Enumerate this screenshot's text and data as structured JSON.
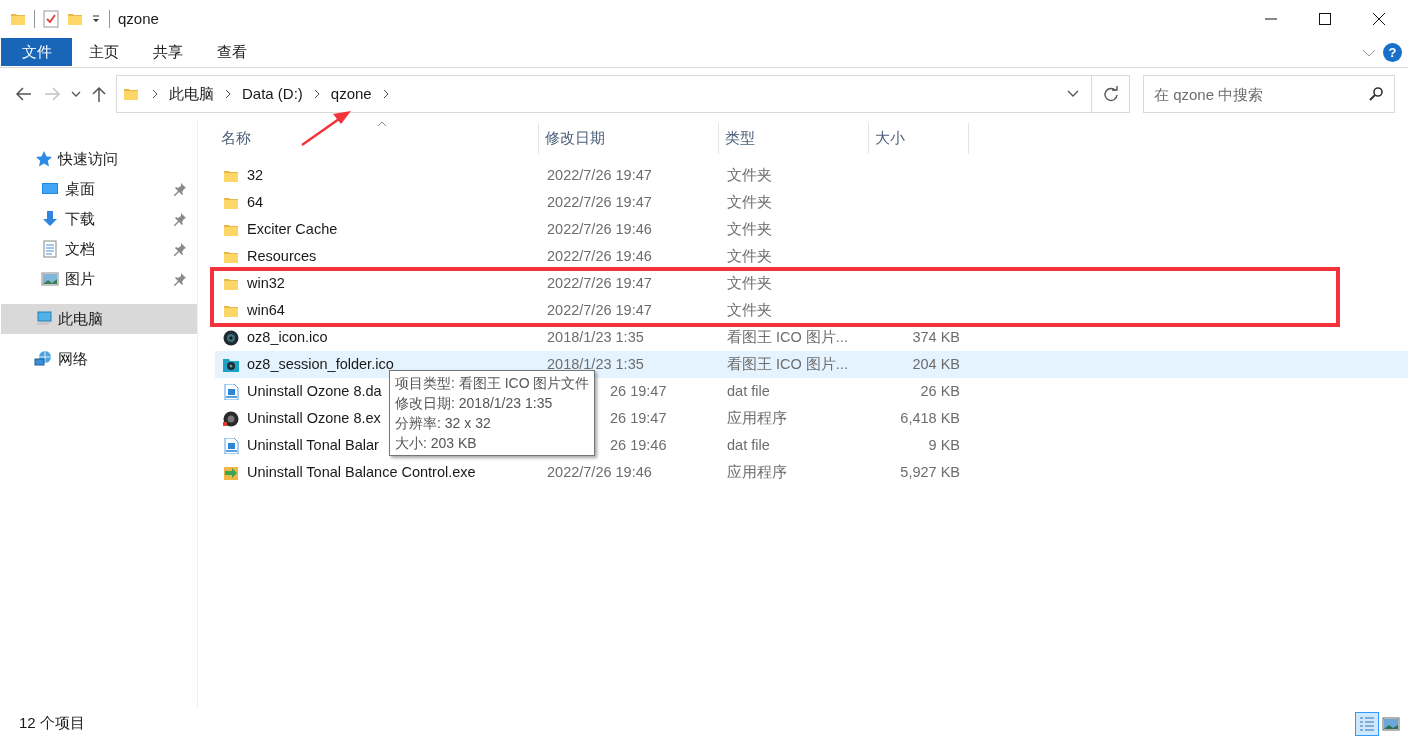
{
  "window": {
    "title": "qzone"
  },
  "ribbon": {
    "tabs": [
      {
        "label": "文件",
        "selected": true
      },
      {
        "label": "主页",
        "selected": false
      },
      {
        "label": "共享",
        "selected": false
      },
      {
        "label": "查看",
        "selected": false
      }
    ],
    "help": "?"
  },
  "address": {
    "back_disabled": false,
    "forward_disabled": true,
    "crumbs": [
      "此电脑",
      "Data (D:)",
      "qzone"
    ],
    "search": {
      "placeholder": "在 qzone 中搜索"
    }
  },
  "sidebar": {
    "items": [
      {
        "label": "快速访问",
        "kind": "star",
        "selected": false,
        "children": [
          {
            "label": "桌面",
            "kind": "desktop",
            "pinned": true,
            "selected": false
          },
          {
            "label": "下载",
            "kind": "download",
            "pinned": true,
            "selected": false
          },
          {
            "label": "文档",
            "kind": "document",
            "pinned": true,
            "selected": false
          },
          {
            "label": "图片",
            "kind": "picture",
            "pinned": true,
            "selected": false
          }
        ]
      },
      {
        "label": "此电脑",
        "kind": "computer",
        "selected": true
      },
      {
        "label": "网络",
        "kind": "network",
        "selected": false
      }
    ]
  },
  "table": {
    "columns": [
      {
        "label": "名称",
        "sorted": true
      },
      {
        "label": "修改日期",
        "sorted": false
      },
      {
        "label": "类型",
        "sorted": false
      },
      {
        "label": "大小",
        "sorted": false
      }
    ],
    "rows": [
      {
        "kind": "folder",
        "name": "32",
        "date": "2022/7/26 19:47",
        "type": "文件夹",
        "hovered": false,
        "highlighted": false
      },
      {
        "kind": "folder",
        "name": "64",
        "date": "2022/7/26 19:47",
        "type": "文件夹",
        "hovered": false,
        "highlighted": false
      },
      {
        "kind": "folder",
        "name": "Exciter Cache",
        "date": "2022/7/26 19:46",
        "type": "文件夹",
        "hovered": false,
        "highlighted": false
      },
      {
        "kind": "folder",
        "name": "Resources",
        "date": "2022/7/26 19:46",
        "type": "文件夹",
        "hovered": false,
        "highlighted": false
      },
      {
        "kind": "folder",
        "name": "win32",
        "date": "2022/7/26 19:47",
        "type": "文件夹",
        "hovered": false,
        "highlighted": true
      },
      {
        "kind": "folder",
        "name": "win64",
        "date": "2022/7/26 19:47",
        "type": "文件夹",
        "hovered": false,
        "highlighted": true
      },
      {
        "kind": "ico",
        "name": "oz8_icon.ico",
        "date": "2018/1/23 1:35",
        "type": "看图王 ICO 图片...",
        "size": "374 KB",
        "hovered": false,
        "highlighted": false
      },
      {
        "kind": "ico-folder",
        "name": "oz8_session_folder.ico",
        "date": "2018/1/23 1:35",
        "type": "看图王 ICO 图片...",
        "size": "204 KB",
        "hovered": true,
        "highlighted": false
      },
      {
        "kind": "dat",
        "name": "Uninstall Ozone 8.da",
        "date": "26 19:47",
        "type": "dat file",
        "size": "26 KB",
        "hovered": false,
        "highlighted": false
      },
      {
        "kind": "exe-dark",
        "name": "Uninstall Ozone 8.ex",
        "date": "26 19:47",
        "type": "应用程序",
        "size": "6,418 KB",
        "hovered": false,
        "highlighted": false
      },
      {
        "kind": "dat",
        "name": "Uninstall Tonal Balar",
        "date": "26 19:46",
        "type": "dat file",
        "size": "9 KB",
        "hovered": false,
        "highlighted": false
      },
      {
        "kind": "exe-arrow",
        "name": "Uninstall Tonal Balance Control.exe",
        "date": "2022/7/26 19:46",
        "type": "应用程序",
        "size": "5,927 KB",
        "hovered": false,
        "highlighted": false
      }
    ]
  },
  "annotations": [
    {
      "kind": "arrow"
    }
  ],
  "tooltip": {
    "lines": [
      "项目类型: 看图王 ICO 图片文件",
      "修改日期: 2018/1/23 1:35",
      "分辨率: 32 x 32",
      "大小: 203 KB"
    ]
  },
  "status_bar": {
    "count": "12 个项目",
    "views": [
      {
        "kind": "details",
        "selected": true
      },
      {
        "kind": "large-icons",
        "selected": false
      }
    ]
  }
}
